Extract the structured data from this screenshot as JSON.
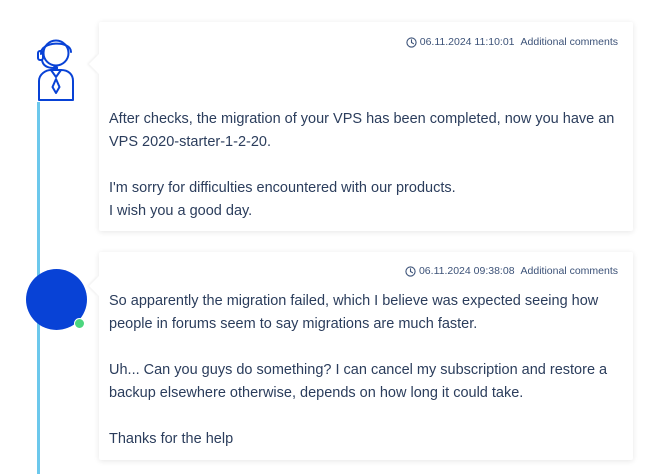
{
  "thread": {
    "messages": [
      {
        "author_role": "support-agent",
        "timestamp": "06.11.2024 11:10:01",
        "comments_link": "Additional comments",
        "paragraphs": [
          "After checks, the migration of your VPS has been completed, now you have an VPS 2020-starter-1-2-20.",
          "I'm sorry for difficulties encountered with our products.",
          "I wish you a good day."
        ]
      },
      {
        "author_role": "customer",
        "timestamp": "06.11.2024 09:38:08",
        "comments_link": "Additional comments",
        "paragraphs": [
          "So apparently the migration failed, which I believe was expected seeing how people in forums seem to say migrations are much faster.",
          "Uh... Can you guys do something? I can cancel my subscription and restore a backup elsewhere otherwise, depends on how long it could take.",
          "Thanks for the help"
        ]
      }
    ]
  },
  "colors": {
    "timeline": "#6cc8ec",
    "user_avatar": "#0842d6",
    "online_status": "#4cd67e",
    "agent_icon": "#0842d6",
    "text": "#2b3d5c",
    "meta_text": "#3c5278"
  },
  "icons": {
    "agent_avatar": "headset-agent-icon",
    "timestamp": "clock-icon"
  }
}
